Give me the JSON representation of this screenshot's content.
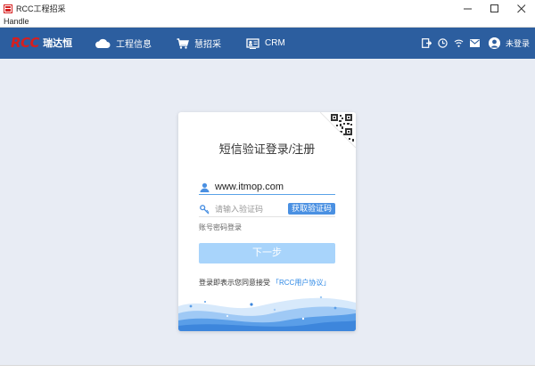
{
  "window": {
    "title": "RCC工程招采",
    "icon": "app-icon",
    "controls": [
      "minimize-icon",
      "maximize-icon",
      "close-icon"
    ]
  },
  "menubar": {
    "items": [
      {
        "label": "Handle"
      }
    ]
  },
  "header": {
    "logo": {
      "brand": "RCC",
      "name": "瑞达恒"
    },
    "nav": [
      {
        "label": "工程信息",
        "icon": "cloud-icon"
      },
      {
        "label": "慧招采",
        "icon": "cart-icon"
      },
      {
        "label": "CRM",
        "icon": "crm-icon"
      }
    ],
    "right_icons": [
      "exit-icon",
      "clock-icon",
      "wifi-icon",
      "mail-icon"
    ],
    "user_status": "未登录",
    "colors": {
      "background": "#2c5e9f",
      "logo_red": "#d61f1f"
    }
  },
  "login": {
    "title": "短信验证登录/注册",
    "phone_value": "www.itmop.com",
    "code_placeholder": "请输入验证码",
    "get_code_label": "获取验证码",
    "password_login_label": "账号密码登录",
    "next_label": "下一步",
    "agreement_text": "登录即表示您同意接受",
    "agreement_link": "「RCC用户协议」",
    "colors": {
      "accent": "#4a90e2",
      "next_disabled": "#a8d4fb",
      "link": "#2d88e6"
    }
  }
}
